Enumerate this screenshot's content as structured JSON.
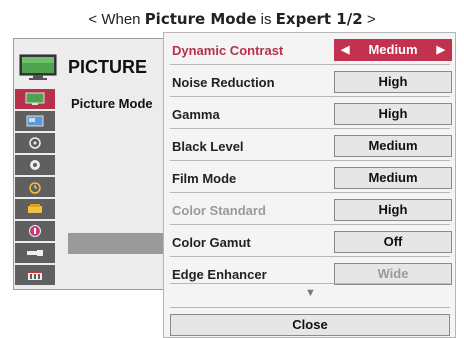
{
  "caption": {
    "prefix": "< When ",
    "mode_name": "Picture Mode",
    "middle": " is ",
    "mode_value": "Expert 1/2",
    "suffix": " >"
  },
  "background_menu": {
    "title": "PICTURE",
    "item": "Picture Mode",
    "icons": [
      "picture-icon",
      "audio-icon",
      "time-icon",
      "option-icon",
      "lock-icon",
      "info-icon",
      "input-icon",
      "media-icon"
    ]
  },
  "submenu": {
    "rows": [
      {
        "label": "Dynamic Contrast",
        "value": "Medium",
        "state": "active"
      },
      {
        "label": "Noise Reduction",
        "value": "High",
        "state": "normal"
      },
      {
        "label": "Gamma",
        "value": "High",
        "state": "normal"
      },
      {
        "label": "Black Level",
        "value": "Medium",
        "state": "normal"
      },
      {
        "label": "Film Mode",
        "value": "Medium",
        "state": "normal"
      },
      {
        "label": "Color Standard",
        "value": "High",
        "state": "label-disabled"
      },
      {
        "label": "Color Gamut",
        "value": "Off",
        "state": "normal"
      },
      {
        "label": "Edge Enhancer",
        "value": "Wide",
        "state": "value-disabled"
      }
    ],
    "arrow_left": "◀",
    "arrow_right": "▶",
    "scroll_down": "▼",
    "close_label": "Close"
  },
  "colors": {
    "accent": "#c2314e",
    "disabled_text": "#9a9a9a",
    "icon_bg": "#5f5f5f"
  }
}
